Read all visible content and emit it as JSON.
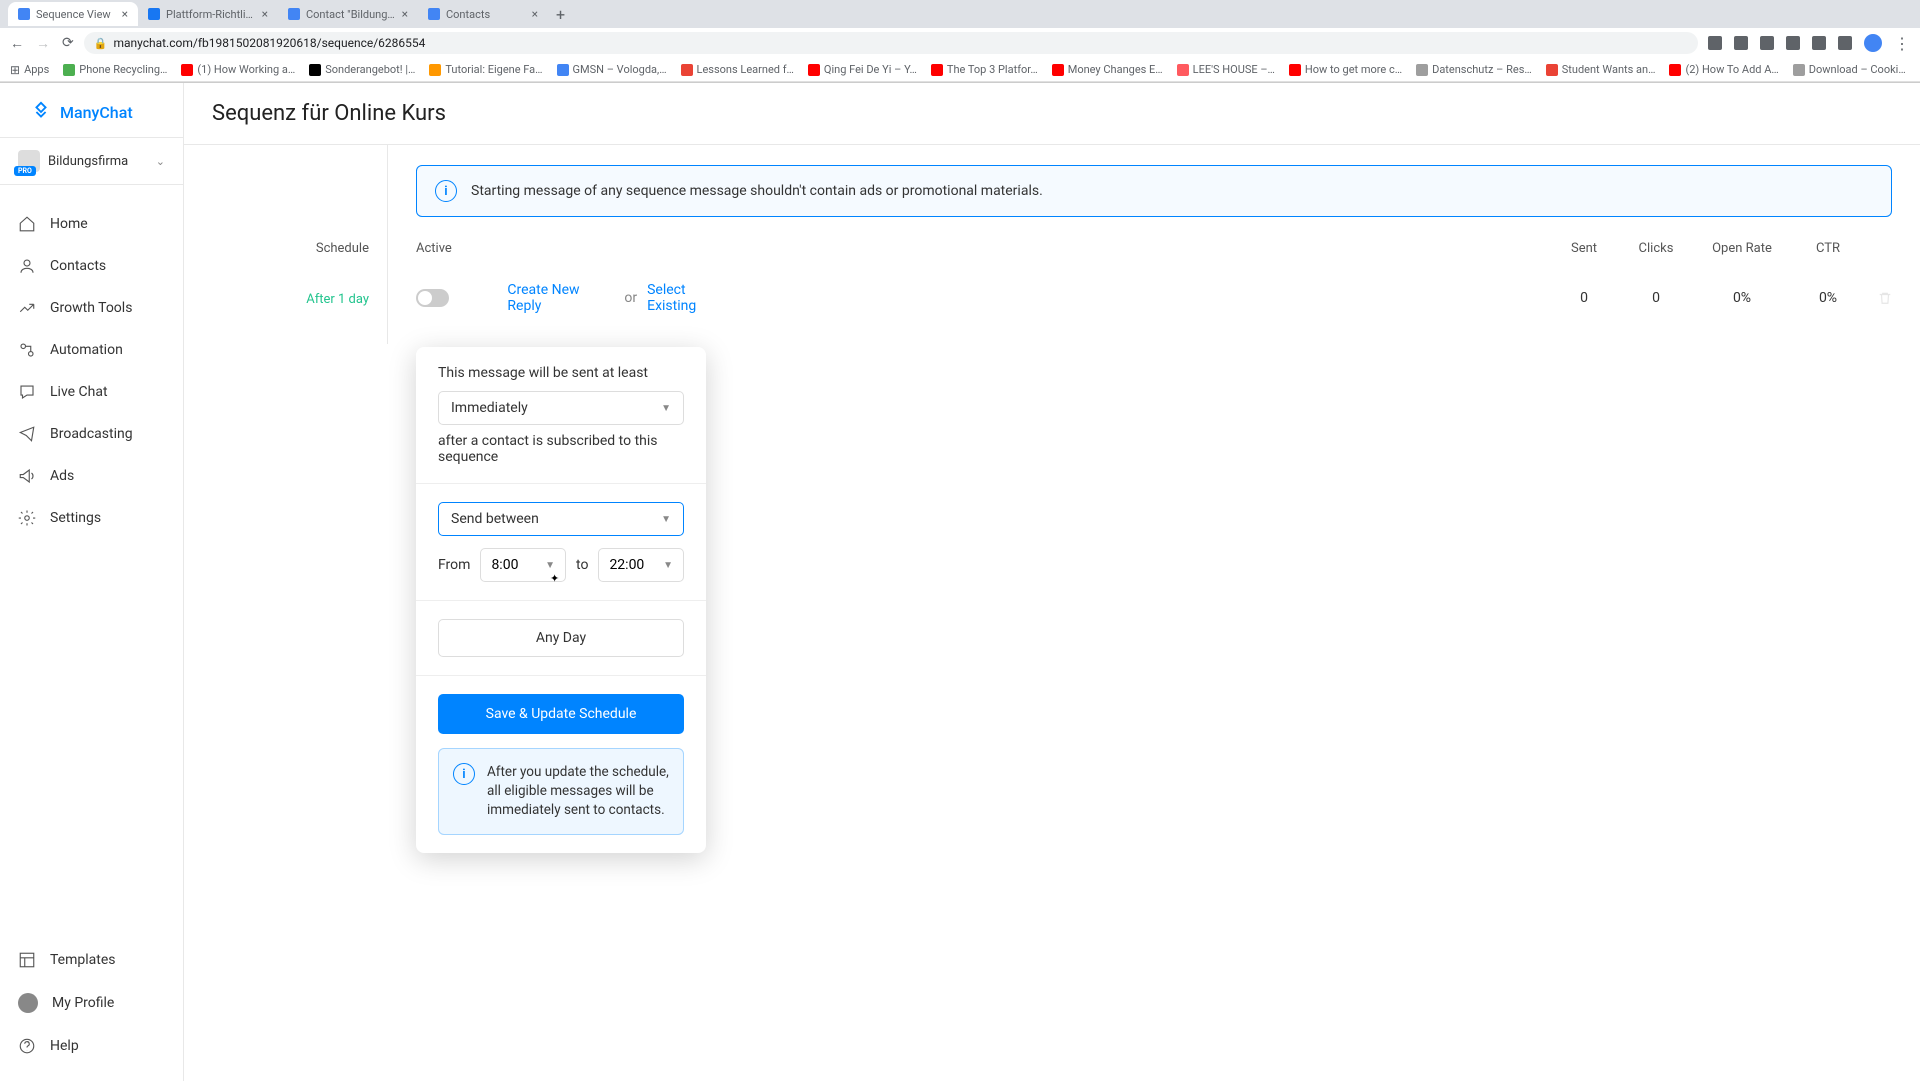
{
  "browser": {
    "tabs": [
      {
        "title": "Sequence View",
        "active": true
      },
      {
        "title": "Plattform-Richtlinien – Übersic",
        "active": false
      },
      {
        "title": "Contact \"Bildungsfirma\" throu",
        "active": false
      },
      {
        "title": "Contacts",
        "active": false
      }
    ],
    "url": "manychat.com/fb1981502081920618/sequence/6286554",
    "bookmarks": [
      {
        "label": "Apps",
        "color": "#5f6368"
      },
      {
        "label": "Phone Recycling…",
        "color": "#4caf50"
      },
      {
        "label": "(1) How Working a…",
        "color": "#ff0000"
      },
      {
        "label": "Sonderangebot! |…",
        "color": "#000"
      },
      {
        "label": "Tutorial: Eigene Fa…",
        "color": "#ff9800"
      },
      {
        "label": "GMSN – Vologda,…",
        "color": "#4285f4"
      },
      {
        "label": "Lessons Learned f…",
        "color": "#ea4335"
      },
      {
        "label": "Qing Fei De Yi – Y…",
        "color": "#ff0000"
      },
      {
        "label": "The Top 3 Platfor…",
        "color": "#ff0000"
      },
      {
        "label": "Money Changes E…",
        "color": "#ff0000"
      },
      {
        "label": "LEE'S HOUSE –…",
        "color": "#ff5a5f"
      },
      {
        "label": "How to get more c…",
        "color": "#ff0000"
      },
      {
        "label": "Datenschutz – Res…",
        "color": "#9e9e9e"
      },
      {
        "label": "Student Wants an…",
        "color": "#ea4335"
      },
      {
        "label": "(2) How To Add A…",
        "color": "#ff0000"
      },
      {
        "label": "Download – Cooki…",
        "color": "#9e9e9e"
      }
    ]
  },
  "app": {
    "logo_text": "ManyChat",
    "workspace": {
      "name": "Bildungsfirma",
      "badge": "PRO"
    },
    "nav": [
      {
        "label": "Home"
      },
      {
        "label": "Contacts"
      },
      {
        "label": "Growth Tools"
      },
      {
        "label": "Automation"
      },
      {
        "label": "Live Chat"
      },
      {
        "label": "Broadcasting"
      },
      {
        "label": "Ads"
      },
      {
        "label": "Settings"
      }
    ],
    "nav_bottom": [
      {
        "label": "Templates"
      },
      {
        "label": "My Profile"
      },
      {
        "label": "Help"
      }
    ]
  },
  "page": {
    "title": "Sequenz für Online Kurs",
    "banner": "Starting message of any sequence message shouldn't contain ads or promotional materials.",
    "columns": {
      "schedule": "Schedule",
      "active": "Active",
      "sent": "Sent",
      "clicks": "Clicks",
      "open_rate": "Open Rate",
      "ctr": "CTR"
    },
    "row": {
      "after": "After 1 day",
      "create_new": "Create New Reply",
      "or": "or",
      "select_existing": "Select Existing",
      "sent": "0",
      "clicks": "0",
      "open_rate": "0%",
      "ctr": "0%"
    }
  },
  "popover": {
    "intro": "This message will be sent at least",
    "immediately": "Immediately",
    "after_subscribe": "after a contact is subscribed to this sequence",
    "send_between": "Send between",
    "from_label": "From",
    "from_time": "8:00",
    "to_label": "to",
    "to_time": "22:00",
    "any_day": "Any Day",
    "save_btn": "Save & Update Schedule",
    "info": "After you update the schedule, all eligible messages will be immediately sent to contacts."
  }
}
